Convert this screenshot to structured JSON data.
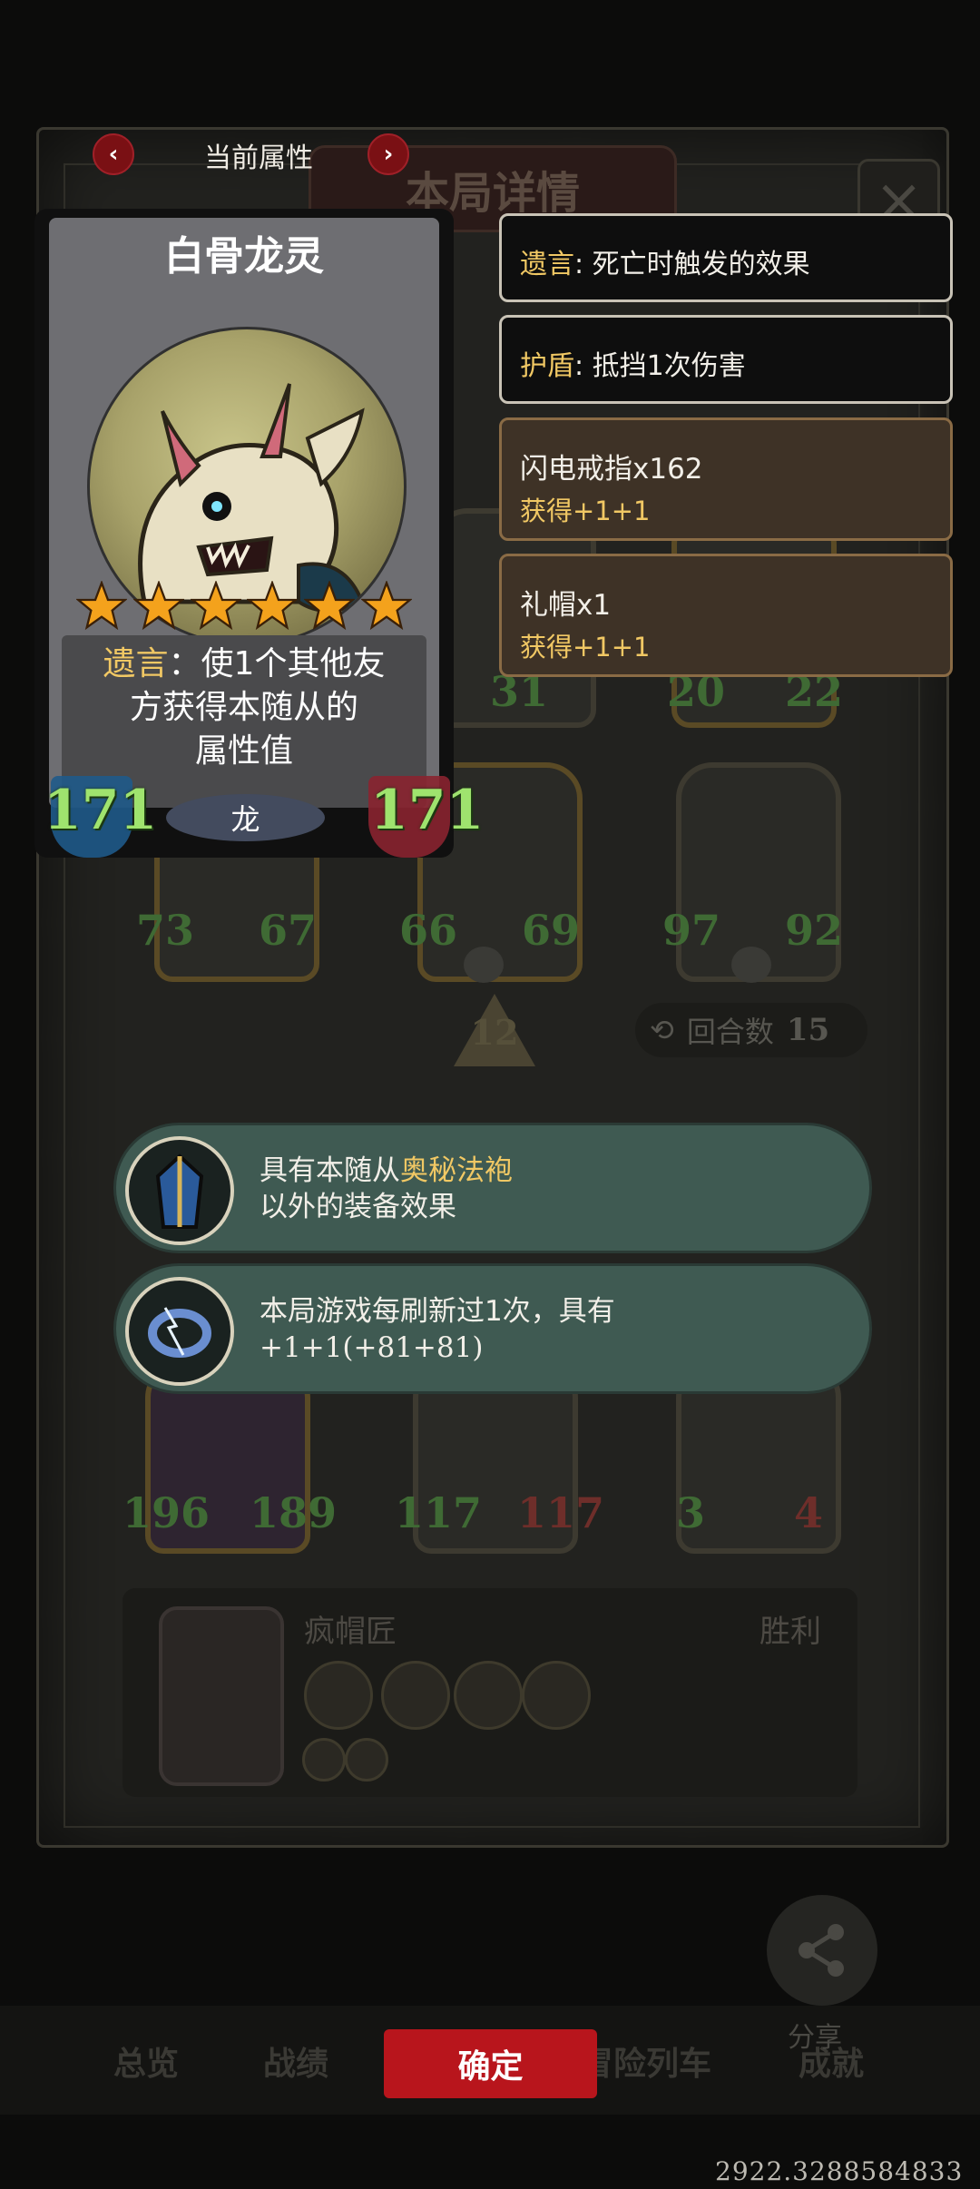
{
  "background": {
    "title": "本局详情",
    "close_label": "×",
    "minion_stats": [
      {
        "atk": "31",
        "hp": ""
      },
      {
        "atk": "20",
        "hp": "22"
      },
      {
        "atk": "73",
        "hp": "67"
      },
      {
        "atk": "66",
        "hp": "69"
      },
      {
        "atk": "97",
        "hp": "92"
      },
      {
        "atk": "196",
        "hp": "189"
      },
      {
        "atk": "117",
        "hp": "117"
      },
      {
        "atk": "3",
        "hp": "4"
      }
    ],
    "level": "12",
    "round_label": "回合数",
    "round_value": "15",
    "player_name": "疯帽匠",
    "player_result": "胜利"
  },
  "attr_nav": {
    "title": "当前属性",
    "prev_icon": "‹",
    "next_icon": "›"
  },
  "card": {
    "name": "白骨龙灵",
    "star_count": 6,
    "desc_keyword": "遗言",
    "desc_line1_rest": "：使1个其他友",
    "desc_line2": "方获得本随从的",
    "desc_line3": "属性值",
    "tribe": "龙",
    "attack": "171",
    "health": "171"
  },
  "tooltips": [
    {
      "keyword": "遗言",
      "text": ": 死亡时触发的效果"
    },
    {
      "keyword": "护盾",
      "text": ": 抵挡1次伤害"
    },
    {
      "line1": "闪电戒指x162",
      "line2": "获得+1+1"
    },
    {
      "line1": "礼帽x1",
      "line2": "获得+1+1"
    }
  ],
  "effects": [
    {
      "line1_prefix": "具有本随从",
      "line1_highlight": "奥秘法袍",
      "line2": "以外的装备效果",
      "icon": "robe-icon"
    },
    {
      "line1": "本局游戏每刷新过1次，具有",
      "line2": "+1+1(+81+81)",
      "icon": "lightning-ring-icon"
    }
  ],
  "bottom_bar": {
    "tabs": [
      "总览",
      "战绩",
      "冒险列车",
      "成就"
    ],
    "confirm_label": "确定",
    "share_label": "分享"
  },
  "coordinates_readout": "2922.3288584833",
  "colors": {
    "keyword_gold": "#f1c864",
    "confirm_red": "#b8151c",
    "effect_teal": "#3f5a52",
    "stat_green": "#9fe36e"
  }
}
